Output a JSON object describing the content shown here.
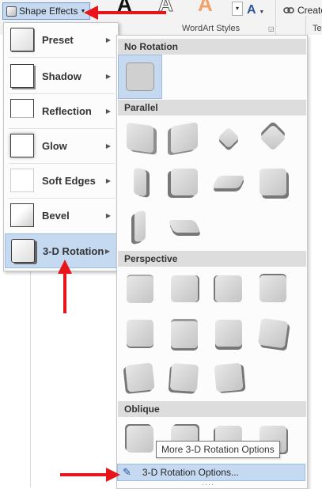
{
  "ribbon": {
    "shape_effects_label": "Shape Effects",
    "wordart_group_label": "WordArt Styles",
    "create_label": "Create",
    "next_tab_label": "Te",
    "wordart_letters": [
      "A",
      "A",
      "A"
    ],
    "text_effects_glyph": "A"
  },
  "menu": {
    "items": [
      {
        "label": "Preset",
        "mnemonic": "P"
      },
      {
        "label": "Shadow",
        "mnemonic": "S"
      },
      {
        "label": "Reflection",
        "mnemonic": "R"
      },
      {
        "label": "Glow",
        "mnemonic": "G"
      },
      {
        "label": "Soft Edges",
        "mnemonic": "E"
      },
      {
        "label": "Bevel",
        "mnemonic": "B"
      },
      {
        "label": "3-D Rotation",
        "mnemonic": "D",
        "active": true
      }
    ]
  },
  "submenu": {
    "sections": [
      {
        "title": "No Rotation",
        "count": 1
      },
      {
        "title": "Parallel",
        "count": 10
      },
      {
        "title": "Perspective",
        "count": 11
      },
      {
        "title": "Oblique",
        "count": 4
      }
    ],
    "tooltip": "More 3-D Rotation Options",
    "options_label": "3-D Rotation Options...",
    "grip": "····"
  },
  "colors": {
    "hover_fill": "#c5d9f1",
    "hover_border": "#9bbde4",
    "section_header": "#dddddd",
    "arrow": "#e8161b"
  },
  "icons": {
    "shape_effects": "shape-effects-icon",
    "submenu_arrow": "chevron-right-icon",
    "options": "3d-rotation-options-icon",
    "annotation": "red-arrow-icon"
  }
}
